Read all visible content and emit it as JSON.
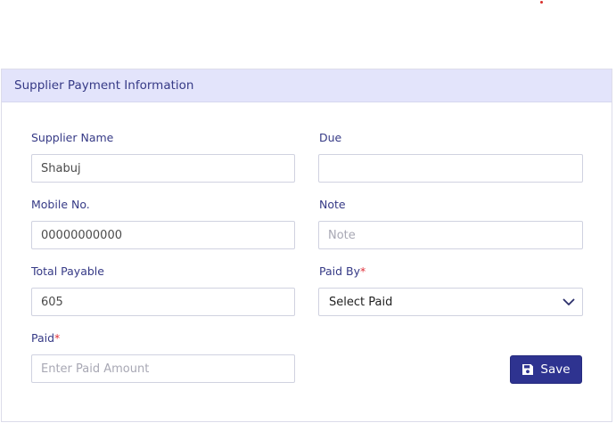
{
  "card": {
    "title": "Supplier Payment Information"
  },
  "form": {
    "supplier_name": {
      "label": "Supplier Name",
      "value": "Shabuj",
      "placeholder": ""
    },
    "due": {
      "label": "Due",
      "value": "",
      "placeholder": ""
    },
    "mobile": {
      "label": "Mobile No.",
      "value": "00000000000",
      "placeholder": ""
    },
    "note": {
      "label": "Note",
      "value": "",
      "placeholder": "Note"
    },
    "total_payable": {
      "label": "Total Payable",
      "value": "605",
      "placeholder": ""
    },
    "paid_by": {
      "label": "Paid By",
      "required_mark": "*",
      "selected": "Select Paid"
    },
    "paid": {
      "label": "Paid",
      "required_mark": "*",
      "value": "",
      "placeholder": "Enter Paid Amount"
    }
  },
  "actions": {
    "save_label": "Save",
    "save_icon": "floppy-disk-icon"
  },
  "icons": {
    "select_chevron": "chevron-down-icon"
  },
  "colors": {
    "header_bg": "#e3e4fb",
    "label": "#363a86",
    "primary": "#2e3390",
    "required": "#e0313b"
  }
}
